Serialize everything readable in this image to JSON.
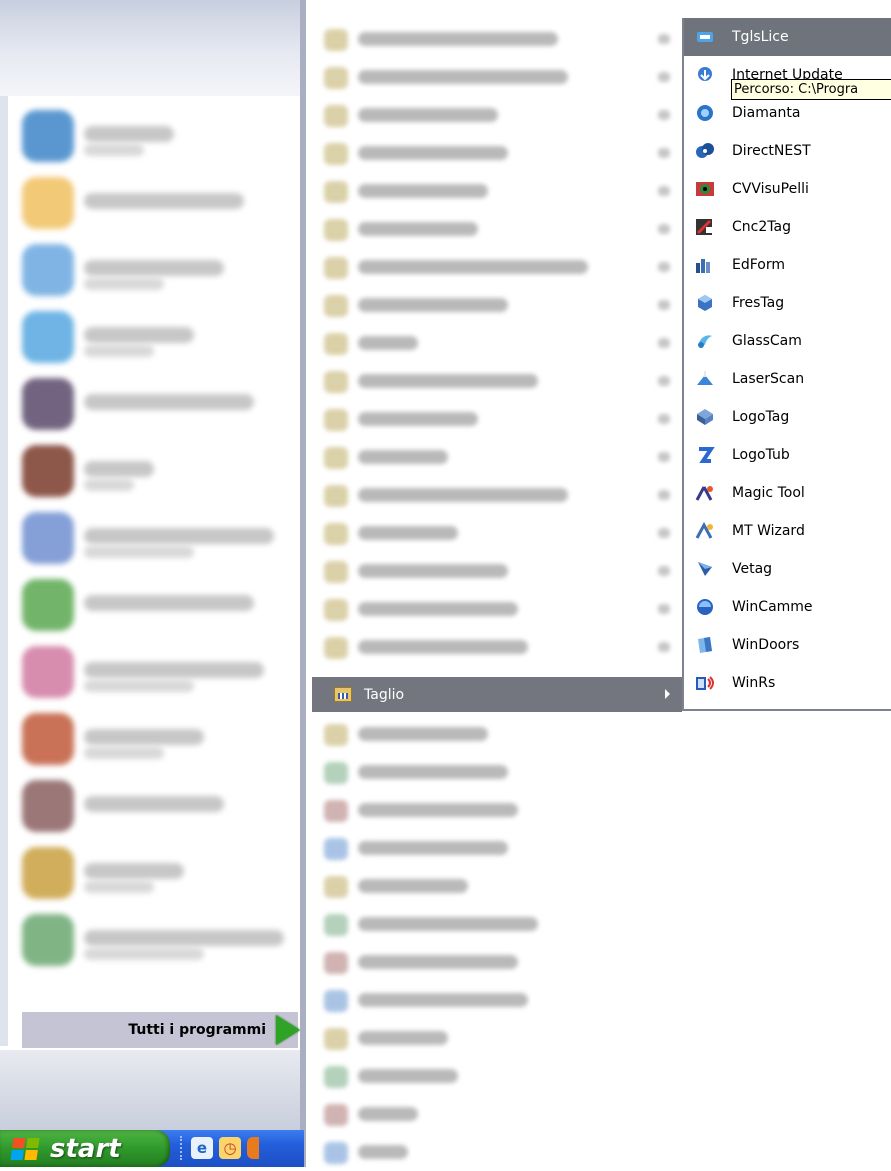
{
  "start_menu": {
    "all_programs_label": "Tutti i programmi",
    "pinned_icon_colors": [
      "#3e86c9",
      "#f0c060",
      "#6aa8e0",
      "#56a8e0",
      "#5a4a6a",
      "#7a3a2a",
      "#7090d0",
      "#5aa850",
      "#d07aa0",
      "#c05a3a",
      "#8a6060",
      "#c8a040",
      "#6aa870"
    ]
  },
  "programs_menu": {
    "highlighted_item": {
      "label": "Taglio",
      "icon": "program-group-icon"
    }
  },
  "submenu": {
    "items": [
      {
        "label": "TglsLice",
        "icon": "tglslice-icon",
        "selected": true
      },
      {
        "label": "Internet Update",
        "icon": "internet-update-icon"
      },
      {
        "label": "Diamanta",
        "icon": "diamanta-icon"
      },
      {
        "label": "DirectNEST",
        "icon": "directnest-icon"
      },
      {
        "label": "CVVisuPelli",
        "icon": "cvvisupelli-icon"
      },
      {
        "label": "Cnc2Tag",
        "icon": "cnc2tag-icon"
      },
      {
        "label": "EdForm",
        "icon": "edform-icon"
      },
      {
        "label": "FresTag",
        "icon": "frestag-icon"
      },
      {
        "label": "GlassCam",
        "icon": "glasscam-icon"
      },
      {
        "label": "LaserScan",
        "icon": "laserscan-icon"
      },
      {
        "label": "LogoTag",
        "icon": "logotag-icon"
      },
      {
        "label": "LogoTub",
        "icon": "logotub-icon"
      },
      {
        "label": "Magic Tool",
        "icon": "magic-tool-icon"
      },
      {
        "label": "MT Wizard",
        "icon": "mt-wizard-icon"
      },
      {
        "label": "Vetag",
        "icon": "vetag-icon"
      },
      {
        "label": "WinCamme",
        "icon": "wincamme-icon"
      },
      {
        "label": "WinDoors",
        "icon": "windoors-icon"
      },
      {
        "label": "WinRs",
        "icon": "winrs-icon"
      }
    ],
    "tooltip": "Percorso: C:\\Progra"
  },
  "taskbar": {
    "start_label": "start",
    "quick_launch": [
      {
        "name": "internet-explorer-icon",
        "glyph": "e"
      },
      {
        "name": "clock-icon",
        "glyph": "◷"
      },
      {
        "name": "firefox-icon",
        "glyph": ""
      }
    ]
  }
}
